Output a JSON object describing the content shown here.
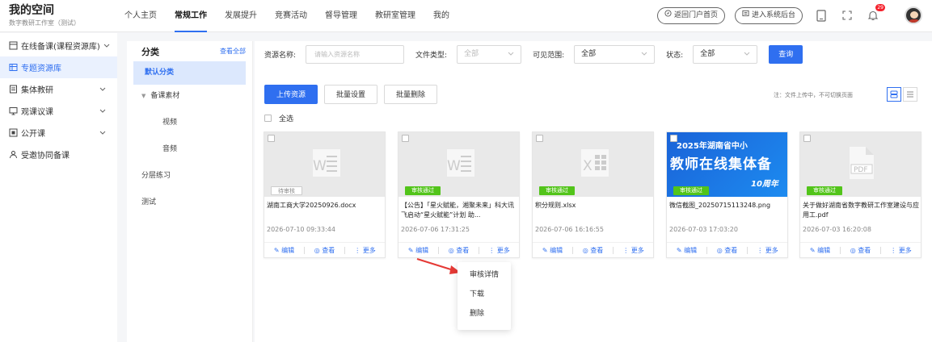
{
  "brand": {
    "title": "我的空间",
    "subtitle": "数字教研工作室（测试）"
  },
  "nav": {
    "items": [
      "个人主页",
      "常规工作",
      "发展提升",
      "竞赛活动",
      "督导管理",
      "教研室管理",
      "我的"
    ],
    "active": 1
  },
  "top_right": {
    "portal_btn": "返回门户首页",
    "admin_btn": "进入系统后台",
    "notification_count": "29"
  },
  "sidebar": {
    "items": [
      {
        "label": "在线备课(课程资源库)",
        "icon": "book-icon",
        "chev": "up"
      },
      {
        "label": "专题资源库",
        "icon": "folder-icon",
        "active": true
      },
      {
        "label": "集体教研",
        "icon": "doc-icon",
        "chev": "down"
      },
      {
        "label": "观课议课",
        "icon": "screen-icon",
        "chev": "down"
      },
      {
        "label": "公开课",
        "icon": "video-icon",
        "chev": "down"
      },
      {
        "label": "受邀协同备课",
        "icon": "group-icon"
      }
    ]
  },
  "category": {
    "title": "分类",
    "view_all": "查看全部",
    "items": [
      {
        "label": "默认分类",
        "kind": "active"
      },
      {
        "label": "备课素材",
        "kind": "parent"
      },
      {
        "label": "视频",
        "kind": "sub"
      },
      {
        "label": "音频",
        "kind": "sub"
      },
      {
        "label": "分层练习",
        "kind": "normal"
      },
      {
        "label": "测试",
        "kind": "normal"
      }
    ]
  },
  "filters": {
    "name_label": "资源名称:",
    "name_placeholder": "请输入资源名称",
    "type_label": "文件类型:",
    "type_value": "全部",
    "scope_label": "可见范围:",
    "scope_value": "全部",
    "status_label": "状态:",
    "status_value": "全部",
    "query_btn": "查询"
  },
  "toolbar": {
    "upload": "上传资源",
    "batch_set": "批量设置",
    "batch_delete": "批量删除",
    "note": "注：文件上传中，不可切换页面",
    "select_all": "全选"
  },
  "actions": {
    "edit": "编辑",
    "view": "查看",
    "more": "更多"
  },
  "cards": [
    {
      "type": "word",
      "status": "待审核",
      "status_kind": "pending",
      "name": "湖南工商大学20250926.docx",
      "date": "2026-07-10 09:33:44"
    },
    {
      "type": "word",
      "status": "审核通过",
      "status_kind": "passed",
      "name": "【公告】「星火赋能，湘聚未来」科大讯飞启动“星火赋能”计划 助...",
      "date": "2026-07-06 17:31:25"
    },
    {
      "type": "excel",
      "status": "审核通过",
      "status_kind": "passed",
      "name": "积分规则.xlsx",
      "date": "2026-07-06 16:16:55"
    },
    {
      "type": "image",
      "status": "审核通过",
      "status_kind": "passed",
      "name": "微信截图_20250715113248.png",
      "date": "2026-07-03 17:03:20",
      "banner": {
        "line1": "2025年湖南省中小",
        "line2": "教师在线集体备",
        "line3": "10周年"
      }
    },
    {
      "type": "pdf",
      "status": "审核通过",
      "status_kind": "passed",
      "name": "关于做好湖南省数字教研工作室建设与应用工.pdf",
      "date": "2026-07-03 16:20:08"
    }
  ],
  "dropdown": {
    "items": [
      "审核详情",
      "下载",
      "删除"
    ]
  },
  "colors": {
    "accent": "#2f6ff0",
    "passed": "#52c41a",
    "annotation_arrow": "#e53935"
  }
}
